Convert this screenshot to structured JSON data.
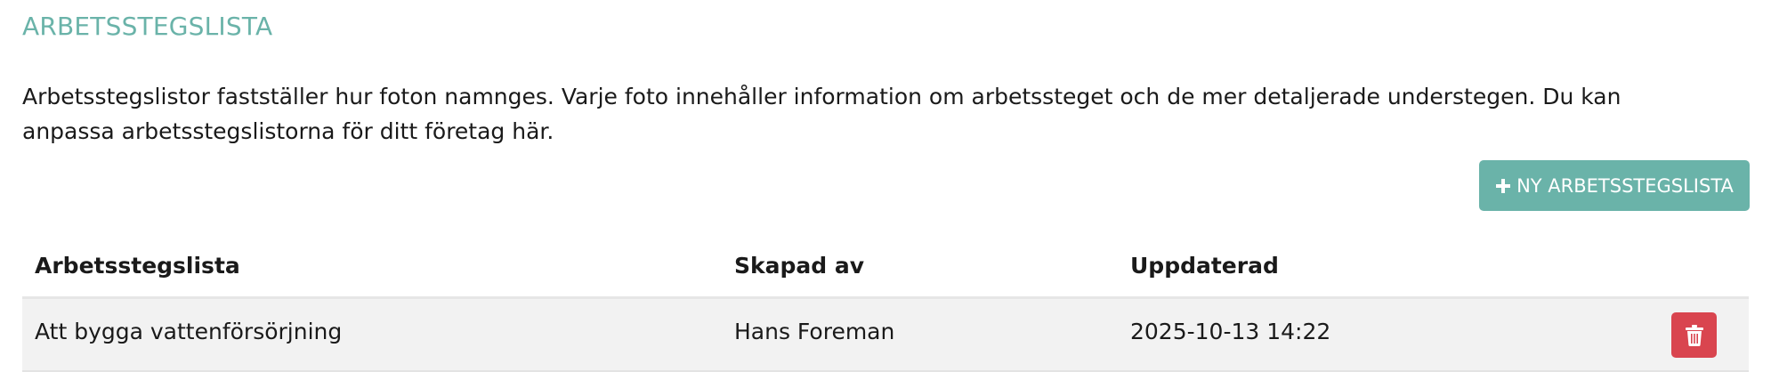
{
  "page": {
    "title": "ARBETSSTEGSLISTA",
    "description": "Arbetsstegslistor fastställer hur foton namnges. Varje foto innehåller information om arbetssteget och de mer detaljerade understegen. Du kan anpassa arbetsstegslistorna för ditt företag här."
  },
  "actions": {
    "new_list_label": "NY ARBETSSTEGSLISTA"
  },
  "table": {
    "headers": [
      "Arbetsstegslista",
      "Skapad av",
      "Uppdaterad"
    ],
    "rows": [
      {
        "name": "Att bygga vattenförsörjning",
        "created_by": "Hans Foreman",
        "updated": "2025-10-13 14:22"
      }
    ]
  },
  "colors": {
    "accent": "#6ab3a9",
    "danger": "#d9454f",
    "row_background": "#f2f2f2"
  },
  "icons": {
    "new_button": "plus-icon",
    "delete_button": "trash-icon"
  }
}
